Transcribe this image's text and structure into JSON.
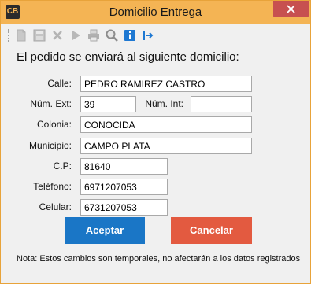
{
  "window": {
    "app_icon_text": "CB",
    "title": "Domicilio Entrega",
    "accent_color": "#f4b454",
    "close_color": "#c75050"
  },
  "toolbar": {
    "icons": [
      "new-document-icon",
      "save-icon",
      "delete-icon",
      "play-icon",
      "print-icon",
      "search-icon",
      "info-icon",
      "export-icon"
    ]
  },
  "form": {
    "heading": "El pedido se enviará al siguiente domicilio:",
    "calle_label": "Calle:",
    "calle_value": "PEDRO RAMIREZ CASTRO",
    "num_ext_label": "Núm. Ext:",
    "num_ext_value": "39",
    "num_int_label": "Núm. Int:",
    "num_int_value": "",
    "colonia_label": "Colonia:",
    "colonia_value": "CONOCIDA",
    "municipio_label": "Municipio:",
    "municipio_value": "CAMPO PLATA",
    "cp_label": "C.P:",
    "cp_value": "81640",
    "telefono_label": "Teléfono:",
    "telefono_value": "6971207053",
    "celular_label": "Celular:",
    "celular_value": "6731207053"
  },
  "actions": {
    "accept_label": "Aceptar",
    "accept_color": "#1a76c6",
    "cancel_label": "Cancelar",
    "cancel_color": "#e35a40"
  },
  "note": "Nota: Estos cambios son temporales, no afectarán a los datos registrados"
}
